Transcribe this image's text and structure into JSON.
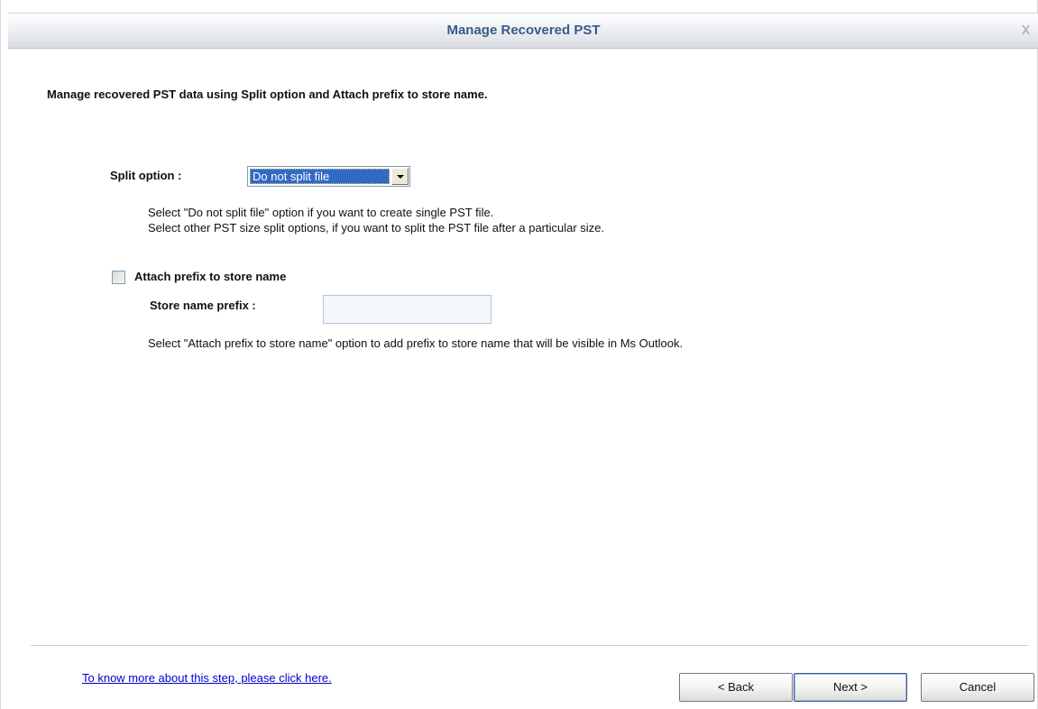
{
  "window": {
    "title": "Manage Recovered PST",
    "close_glyph": "x"
  },
  "main": {
    "heading": "Manage recovered PST data using Split option and Attach prefix to store name.",
    "split": {
      "label": "Split option :",
      "selected_value": "Do not split file",
      "help_lines": [
        "Select \"Do not split file\" option if you want to create single PST file.",
        "Select other PST size split options, if you want to split the PST file after a particular size."
      ]
    },
    "prefix": {
      "checkbox_label": "Attach prefix to store name",
      "checked": false,
      "field_label": "Store name prefix :",
      "field_value": "",
      "help": "Select \"Attach prefix to store name\" option to add prefix to store name that will be visible in Ms Outlook."
    }
  },
  "footer": {
    "help_link": "To know more about this step, please click here.",
    "back_label": "< Back",
    "next_label": "Next >",
    "cancel_label": "Cancel"
  },
  "icons": {
    "close": "close-icon",
    "dropdown": "chevron-down-icon"
  },
  "colors": {
    "title_text": "#3a5a8a",
    "selection": "#316ac5",
    "link": "#0000cc"
  }
}
